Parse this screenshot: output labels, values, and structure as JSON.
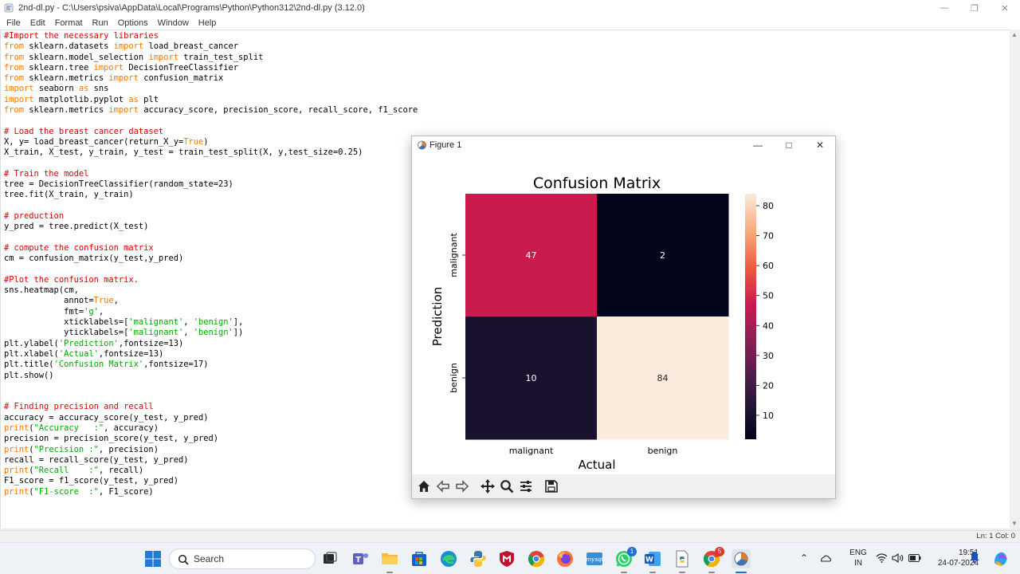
{
  "idle": {
    "title": "2nd-dl.py - C:\\Users\\psiva\\AppData\\Local\\Programs\\Python\\Python312\\2nd-dl.py (3.12.0)",
    "menu": [
      "File",
      "Edit",
      "Format",
      "Run",
      "Options",
      "Window",
      "Help"
    ],
    "status": "Ln: 1   Col: 0"
  },
  "code_lines": [
    [
      [
        "cm",
        "#Import the necessary libraries"
      ]
    ],
    [
      [
        "kw",
        "from"
      ],
      [
        "",
        " sklearn.datasets "
      ],
      [
        "kw",
        "import"
      ],
      [
        "",
        " load_breast_cancer"
      ]
    ],
    [
      [
        "kw",
        "from"
      ],
      [
        "",
        " sklearn.model_selection "
      ],
      [
        "kw",
        "import"
      ],
      [
        "",
        " train_test_split"
      ]
    ],
    [
      [
        "kw",
        "from"
      ],
      [
        "",
        " sklearn.tree "
      ],
      [
        "kw",
        "import"
      ],
      [
        "",
        " DecisionTreeClassifier"
      ]
    ],
    [
      [
        "kw",
        "from"
      ],
      [
        "",
        " sklearn.metrics "
      ],
      [
        "kw",
        "import"
      ],
      [
        "",
        " confusion_matrix"
      ]
    ],
    [
      [
        "kw",
        "import"
      ],
      [
        "",
        " seaborn "
      ],
      [
        "kw",
        "as"
      ],
      [
        "",
        " sns"
      ]
    ],
    [
      [
        "kw",
        "import"
      ],
      [
        "",
        " matplotlib.pyplot "
      ],
      [
        "kw",
        "as"
      ],
      [
        "",
        " plt"
      ]
    ],
    [
      [
        "kw",
        "from"
      ],
      [
        "",
        " sklearn.metrics "
      ],
      [
        "kw",
        "import"
      ],
      [
        "",
        " accuracy_score, precision_score, recall_score, f1_score"
      ]
    ],
    [],
    [
      [
        "cm",
        "# Load the breast cancer dataset"
      ]
    ],
    [
      [
        "",
        "X, y= load_breast_cancer(return_X_y="
      ],
      [
        "kw",
        "True"
      ],
      [
        "",
        ")"
      ]
    ],
    [
      [
        "",
        "X_train, X_test, y_train, y_test = train_test_split(X, y,test_size=0.25)"
      ]
    ],
    [],
    [
      [
        "cm",
        "# Train the model"
      ]
    ],
    [
      [
        "",
        "tree = DecisionTreeClassifier(random_state=23)"
      ]
    ],
    [
      [
        "",
        "tree.fit(X_train, y_train)"
      ]
    ],
    [],
    [
      [
        "cm",
        "# preduction"
      ]
    ],
    [
      [
        "",
        "y_pred = tree.predict(X_test)"
      ]
    ],
    [],
    [
      [
        "cm",
        "# compute the confusion matrix"
      ]
    ],
    [
      [
        "",
        "cm = confusion_matrix(y_test,y_pred)"
      ]
    ],
    [],
    [
      [
        "cm",
        "#Plot the confusion matrix."
      ]
    ],
    [
      [
        "",
        "sns.heatmap(cm,"
      ]
    ],
    [
      [
        "",
        "            annot="
      ],
      [
        "kw",
        "True"
      ],
      [
        "",
        ","
      ]
    ],
    [
      [
        "",
        "            fmt="
      ],
      [
        "st",
        "'g'"
      ],
      [
        "",
        ","
      ]
    ],
    [
      [
        "",
        "            xticklabels=["
      ],
      [
        "st",
        "'malignant'"
      ],
      [
        "",
        ", "
      ],
      [
        "st",
        "'benign'"
      ],
      [
        "",
        "],"
      ]
    ],
    [
      [
        "",
        "            yticklabels=["
      ],
      [
        "st",
        "'malignant'"
      ],
      [
        "",
        ", "
      ],
      [
        "st",
        "'benign'"
      ],
      [
        "",
        "])"
      ]
    ],
    [
      [
        "",
        "plt.ylabel("
      ],
      [
        "st",
        "'Prediction'"
      ],
      [
        "",
        ",fontsize=13)"
      ]
    ],
    [
      [
        "",
        "plt.xlabel("
      ],
      [
        "st",
        "'Actual'"
      ],
      [
        "",
        ",fontsize=13)"
      ]
    ],
    [
      [
        "",
        "plt.title("
      ],
      [
        "st",
        "'Confusion Matrix'"
      ],
      [
        "",
        ",fontsize=17)"
      ]
    ],
    [
      [
        "",
        "plt.show()"
      ]
    ],
    [],
    [],
    [
      [
        "cm",
        "# Finding precision and recall"
      ]
    ],
    [
      [
        "",
        "accuracy = accuracy_score(y_test, y_pred)"
      ]
    ],
    [
      [
        "kw",
        "print"
      ],
      [
        "",
        "("
      ],
      [
        "st",
        "\"Accuracy   :\""
      ],
      [
        "",
        ", accuracy)"
      ]
    ],
    [
      [
        "",
        "precision = precision_score(y_test, y_pred)"
      ]
    ],
    [
      [
        "kw",
        "print"
      ],
      [
        "",
        "("
      ],
      [
        "st",
        "\"Precision :\""
      ],
      [
        "",
        ", precision)"
      ]
    ],
    [
      [
        "",
        "recall = recall_score(y_test, y_pred)"
      ]
    ],
    [
      [
        "kw",
        "print"
      ],
      [
        "",
        "("
      ],
      [
        "st",
        "\"Recall    :\""
      ],
      [
        "",
        ", recall)"
      ]
    ],
    [
      [
        "",
        "F1_score = f1_score(y_test, y_pred)"
      ]
    ],
    [
      [
        "kw",
        "print"
      ],
      [
        "",
        "("
      ],
      [
        "st",
        "\"F1-score  :\""
      ],
      [
        "",
        ", F1_score)"
      ]
    ]
  ],
  "figure": {
    "window_title": "Figure 1",
    "toolbar": [
      "home-icon",
      "back-icon",
      "forward-icon",
      "pan-icon",
      "zoom-icon",
      "configure-icon",
      "save-icon"
    ]
  },
  "chart_data": {
    "type": "heatmap",
    "title": "Confusion Matrix",
    "xlabel": "Actual",
    "ylabel": "Prediction",
    "x_categories": [
      "malignant",
      "benign"
    ],
    "y_categories": [
      "malignant",
      "benign"
    ],
    "values": [
      [
        47,
        2
      ],
      [
        10,
        84
      ]
    ],
    "colorbar_ticks": [
      10,
      20,
      30,
      40,
      50,
      60,
      70,
      80
    ],
    "colormap": "rocket"
  },
  "taskbar": {
    "search_label": "Search",
    "language_line1": "ENG",
    "language_line2": "IN",
    "time": "19:51",
    "date": "24-07-2024",
    "whatsapp_badge": "1",
    "chrome_badge": "5"
  }
}
